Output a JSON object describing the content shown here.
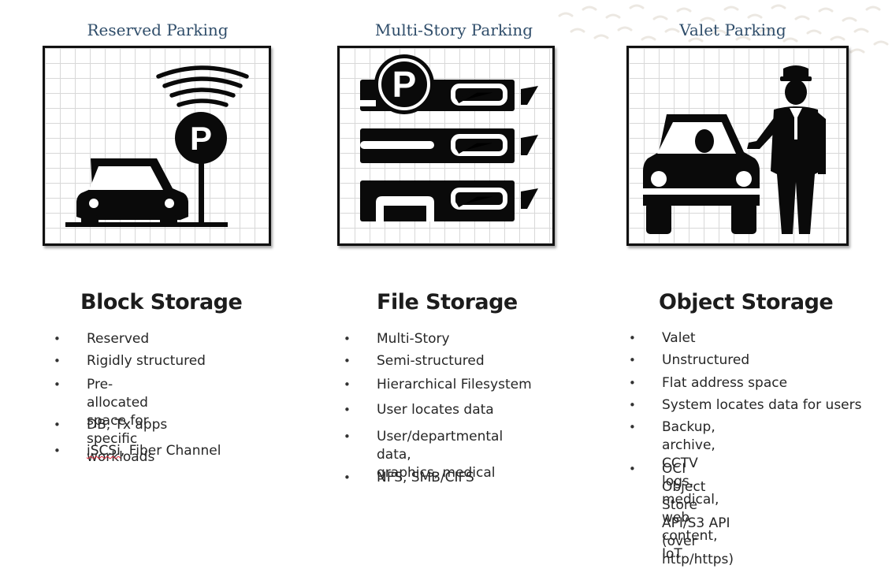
{
  "columns": [
    {
      "caption": "Reserved Parking",
      "illustration_icon": "reserved-parking-car-sign-icon",
      "heading": "Block Storage",
      "bullets": [
        "Reserved",
        "Rigidly structured",
        "Pre-allocated space for\nspecific workloads",
        "DB, Tx apps",
        "Fiber Channel"
      ],
      "last_bullet_prefix": "iSCSi"
    },
    {
      "caption": "Multi-Story Parking",
      "illustration_icon": "multi-story-parking-garage-icon",
      "heading": "File Storage",
      "bullets": [
        "Multi-Story",
        "Semi-structured",
        "Hierarchical Filesystem",
        "User locates data",
        "User/departmental data,\ngraphics, medical",
        "NFS, SMB/CIFS"
      ]
    },
    {
      "caption": "Valet Parking",
      "illustration_icon": "valet-attendant-car-icon",
      "heading": "Object Storage",
      "bullets": [
        "Valet",
        "Unstructured",
        "Flat address space",
        "System locates data for users",
        "Backup, archive, CCTV logs,\nmedical, web content, IoT",
        "OCI Object Store API/S3 API (over\nhttp/https)"
      ]
    }
  ],
  "colors": {
    "caption": "#2f4d6a",
    "icon": "#0a0a0a",
    "grid": "#d8d8d8"
  }
}
